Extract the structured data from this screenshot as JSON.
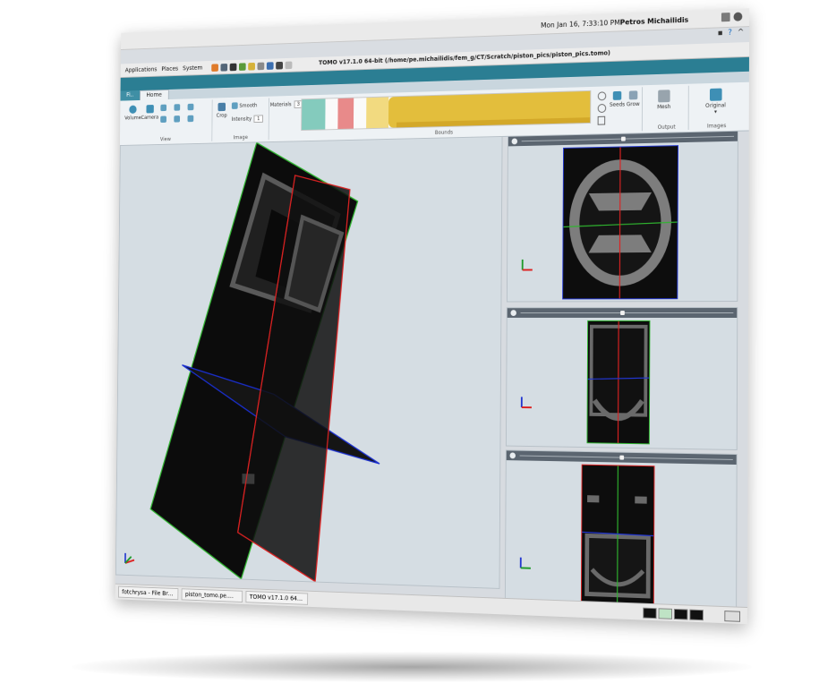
{
  "os": {
    "clock": "Mon Jan 16,  7:33:10 PM",
    "user": "Petros Michailidis",
    "menus": [
      "Applications",
      "Places",
      "System"
    ]
  },
  "window": {
    "title": "TOMO v17.1.0 64-bit (/home/pe.michailidis/fem_g/CT/Scratch/piston_pics/piston_pics.tomo)"
  },
  "ribbon": {
    "tabs": [
      "Fi..",
      "Home"
    ],
    "view": {
      "volume": "Volume",
      "camera": "Camera",
      "group": "View"
    },
    "image": {
      "crop": "Crop",
      "smooth": "Smooth",
      "intensity": "Intensity",
      "intensity_val": "1",
      "group": "Image"
    },
    "bounds": {
      "materials": "Materials",
      "materials_val": "3",
      "group": "Bounds"
    },
    "tools": {
      "seeds": "Seeds",
      "grow": "Grow"
    },
    "output": {
      "mesh": "Mesh",
      "group": "Output"
    },
    "images": {
      "original": "Original",
      "group": "Images"
    }
  },
  "taskbar": {
    "items": [
      "fotchrysa - File Brow...",
      "piston_tomo.pe.mich...",
      "TOMO v17.1.0 64-bit..."
    ]
  },
  "colors": {
    "accent": "#2b7e93",
    "bounds_teal": "#84cbbd",
    "bounds_red": "#e88a8a",
    "bounds_gold": "#e3be3c"
  }
}
